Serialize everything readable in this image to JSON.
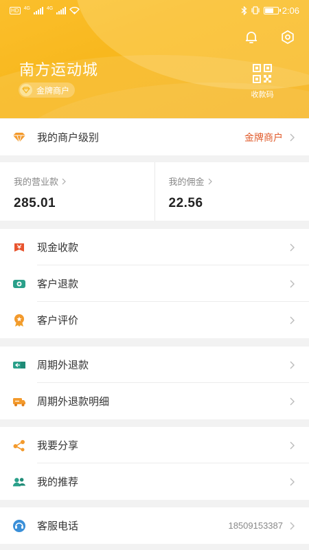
{
  "status_bar": {
    "net_badge": "HD",
    "sim1": "4G",
    "sim2": "4G",
    "time": "2:06"
  },
  "header": {
    "store_name": "南方运动城",
    "merchant_tag": "金牌商户",
    "qr_label": "收款码",
    "colors": {
      "bg_start": "#fbbf2c",
      "bg_end": "#f6b31a"
    }
  },
  "level": {
    "label": "我的商户级别",
    "value": "金牌商户",
    "value_color": "#e05a2a"
  },
  "stats": {
    "revenue_title": "我的营业款",
    "revenue_value": "285.01",
    "commission_title": "我的佣金",
    "commission_value": "22.56"
  },
  "group1": [
    {
      "label": "现金收款",
      "icon": "cash-icon"
    },
    {
      "label": "客户退款",
      "icon": "refund-icon"
    },
    {
      "label": "客户评价",
      "icon": "review-icon"
    }
  ],
  "group2": [
    {
      "label": "周期外退款",
      "icon": "period-refund-icon"
    },
    {
      "label": "周期外退款明细",
      "icon": "refund-detail-icon"
    }
  ],
  "group3": [
    {
      "label": "我要分享",
      "icon": "share-icon"
    },
    {
      "label": "我的推荐",
      "icon": "referral-icon"
    }
  ],
  "service": {
    "label": "客服电话",
    "phone": "18509153387",
    "icon": "customer-service-icon"
  }
}
